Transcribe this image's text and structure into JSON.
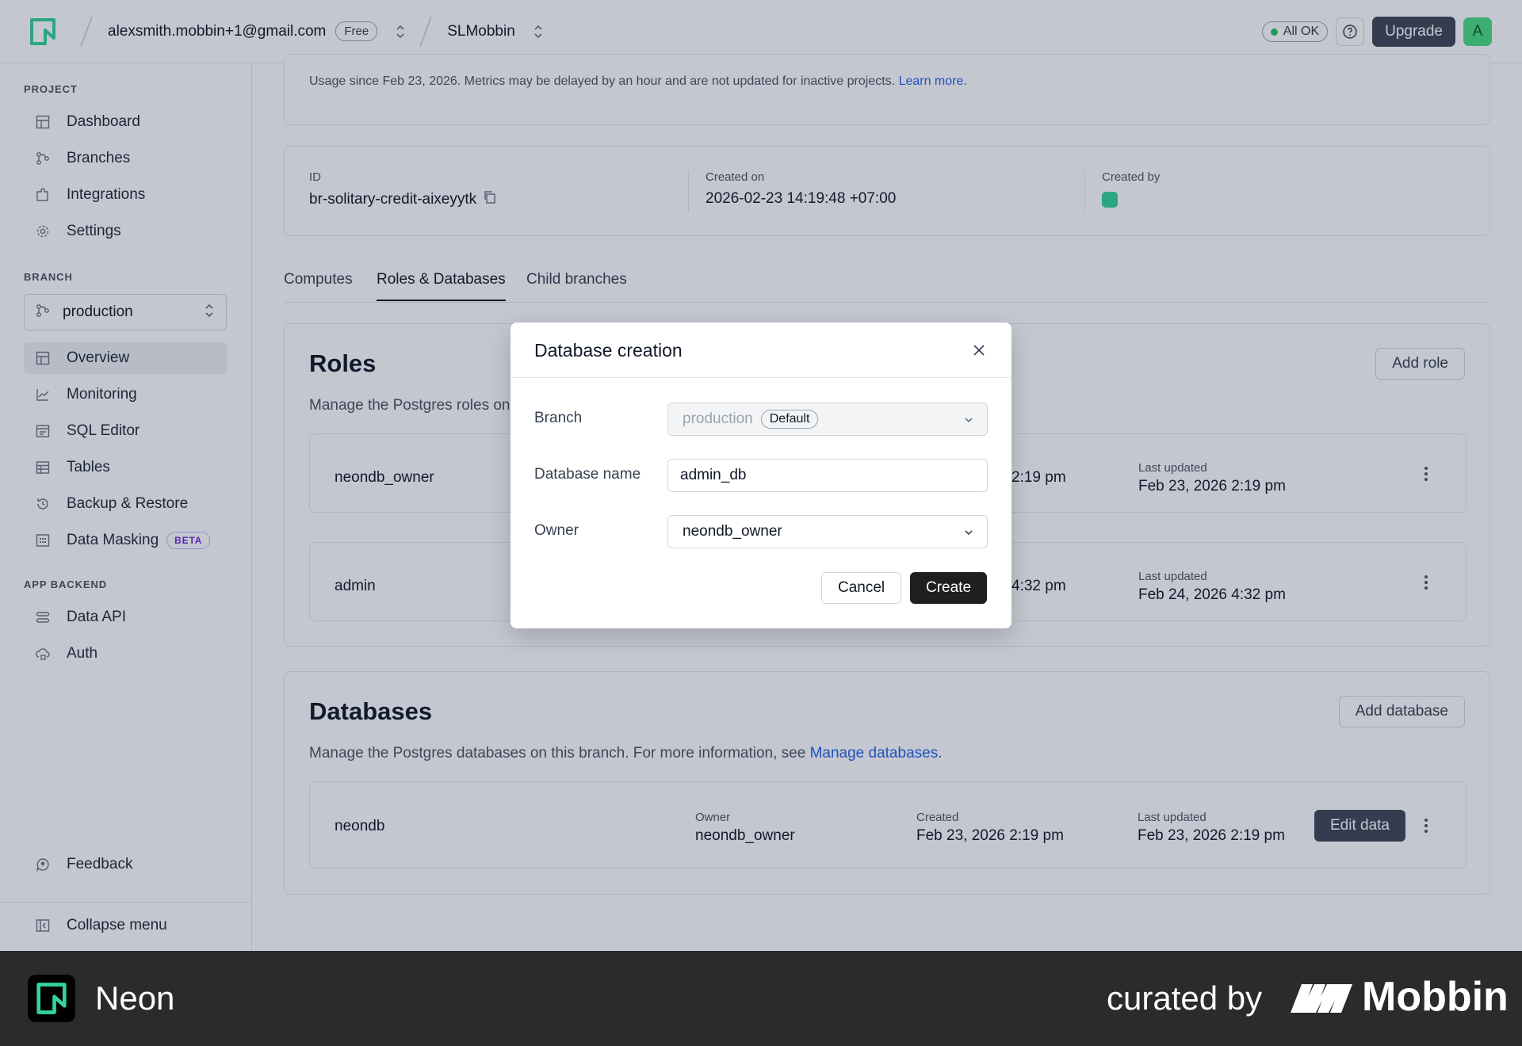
{
  "topbar": {
    "account": "alexsmith.mobbin+1@gmail.com",
    "plan": "Free",
    "project": "SLMobbin",
    "status": "All OK",
    "upgrade": "Upgrade",
    "avatar_letter": "A"
  },
  "sidebar": {
    "project_title": "PROJECT",
    "project_items": [
      {
        "label": "Dashboard",
        "icon": "grid-icon"
      },
      {
        "label": "Branches",
        "icon": "branch-icon"
      },
      {
        "label": "Integrations",
        "icon": "puzzle-icon"
      },
      {
        "label": "Settings",
        "icon": "gear-icon"
      }
    ],
    "branch_title": "BRANCH",
    "branch_value": "production",
    "branch_items": [
      {
        "label": "Overview",
        "icon": "grid-icon"
      },
      {
        "label": "Monitoring",
        "icon": "chart-icon"
      },
      {
        "label": "SQL Editor",
        "icon": "editor-icon"
      },
      {
        "label": "Tables",
        "icon": "table-icon"
      },
      {
        "label": "Backup & Restore",
        "icon": "history-icon"
      },
      {
        "label": "Data Masking",
        "icon": "mask-icon",
        "badge": "BETA"
      }
    ],
    "backend_title": "APP BACKEND",
    "backend_items": [
      {
        "label": "Data API",
        "icon": "api-icon"
      },
      {
        "label": "Auth",
        "icon": "cloud-lock-icon"
      }
    ],
    "feedback": "Feedback",
    "collapse": "Collapse menu"
  },
  "usage": {
    "text": "Usage since Feb 23, 2026. Metrics may be delayed by an hour and are not updated for inactive projects.",
    "link": "Learn more."
  },
  "meta": {
    "id_label": "ID",
    "id_value": "br-solitary-credit-aixeyytk",
    "created_on_label": "Created on",
    "created_on_value": "2026-02-23 14:19:48 +07:00",
    "created_by_label": "Created by"
  },
  "tabs": [
    "Computes",
    "Roles & Databases",
    "Child branches"
  ],
  "roles": {
    "title": "Roles",
    "desc": "Manage the Postgres roles on",
    "add_button": "Add role",
    "rows": [
      {
        "name": "neondb_owner",
        "created_partial": "2:19 pm",
        "updated_label": "Last updated",
        "updated_value": "Feb 23, 2026 2:19 pm"
      },
      {
        "name": "admin",
        "created_partial": "4:32 pm",
        "updated_label": "Last updated",
        "updated_value": "Feb 24, 2026 4:32 pm"
      }
    ]
  },
  "databases": {
    "title": "Databases",
    "desc": "Manage the Postgres databases on this branch. For more information, see",
    "desc_link": "Manage databases",
    "desc_end": ".",
    "add_button": "Add database",
    "rows": [
      {
        "name": "neondb",
        "owner_label": "Owner",
        "owner_value": "neondb_owner",
        "created_label": "Created",
        "created_value": "Feb 23, 2026 2:19 pm",
        "updated_label": "Last updated",
        "updated_value": "Feb 23, 2026 2:19 pm",
        "edit": "Edit data"
      }
    ]
  },
  "modal": {
    "title": "Database creation",
    "branch_label": "Branch",
    "branch_value": "production",
    "branch_badge": "Default",
    "name_label": "Database name",
    "name_value": "admin_db",
    "owner_label": "Owner",
    "owner_value": "neondb_owner",
    "cancel": "Cancel",
    "create": "Create"
  },
  "footer": {
    "app_name": "Neon",
    "curated": "curated by",
    "brand": "Mobbin"
  },
  "colors": {
    "accent": "#2563eb",
    "neon_green": "#34d399",
    "dark_button": "#1f1f1f"
  }
}
